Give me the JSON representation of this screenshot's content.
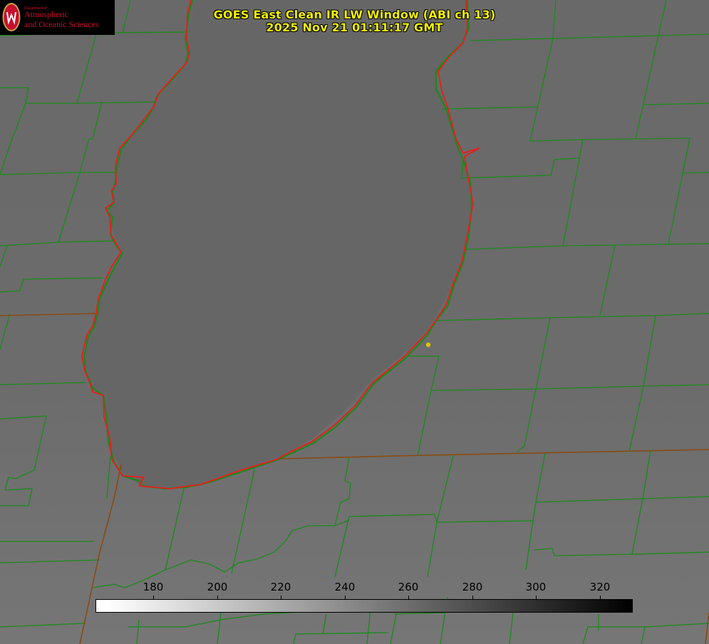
{
  "title": {
    "line1": "GOES East Clean IR LW Window (ABI ch 13)",
    "line2": "2025 Nov 21 01:11:17 GMT"
  },
  "logo": {
    "dept": "Department of",
    "line1": "Atmospheric",
    "line2": "and Oceanic Sciences"
  },
  "colorbar": {
    "ticks": [
      "180",
      "200",
      "220",
      "240",
      "260",
      "280",
      "300",
      "320"
    ]
  },
  "colors": {
    "background": "#6b6b6b",
    "lake": "#676767",
    "county_border": "#1a8a1a",
    "state_border": "#8a4a10",
    "coastline": "#ff2020",
    "title": "#f2f200",
    "marker": "#d8c800"
  },
  "icons": {
    "logo": "uw-seal-icon",
    "marker": "station-dot-icon"
  }
}
